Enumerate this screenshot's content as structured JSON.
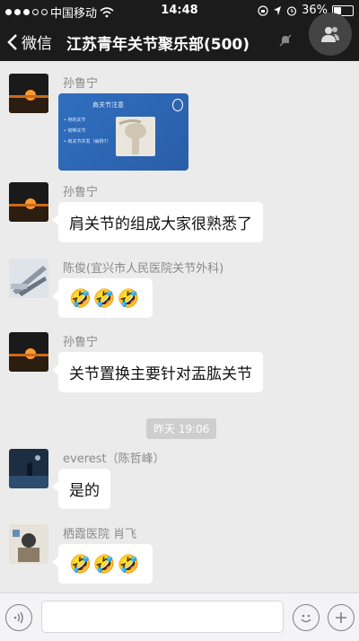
{
  "status_bar": {
    "carrier": "中国移动",
    "time": "14:48",
    "battery": "36%",
    "battery_level": 0.36
  },
  "nav": {
    "back_label": "微信",
    "title": "江苏青年关节聚乐部(500)"
  },
  "messages": [
    {
      "sender": "孙鲁宁",
      "type": "image",
      "slide": {
        "title": "肩关节注意",
        "bullets": [
          "• 骨的关节",
          "• 韧带关节",
          "• 肩关节并发（病例7）"
        ]
      }
    },
    {
      "sender": "孙鲁宁",
      "type": "text",
      "text": "肩关节的组成大家很熟悉了"
    },
    {
      "sender": "陈俊(宜兴市人民医院关节外科)",
      "type": "emoji",
      "text": "🤣🤣🤣"
    },
    {
      "sender": "孙鲁宁",
      "type": "text",
      "text": "关节置换主要针对盂肱关节"
    },
    {
      "sender": "everest（陈哲峰）",
      "type": "text",
      "text": "是的"
    },
    {
      "sender": "栖霞医院 肖飞",
      "type": "emoji",
      "text": "🤣🤣🤣"
    }
  ],
  "timestamp": "昨天 19:06",
  "icons": {
    "back": "chevron-left-icon",
    "mute": "mute-bell-icon",
    "members": "group-members-icon",
    "voice": "voice-icon",
    "emoji": "emoji-face-icon",
    "more": "plus-icon"
  },
  "colors": {
    "bar": "#1b1b1b",
    "chat_bg": "#ebebeb",
    "bubble": "#ffffff",
    "name": "#8a8a8a"
  }
}
